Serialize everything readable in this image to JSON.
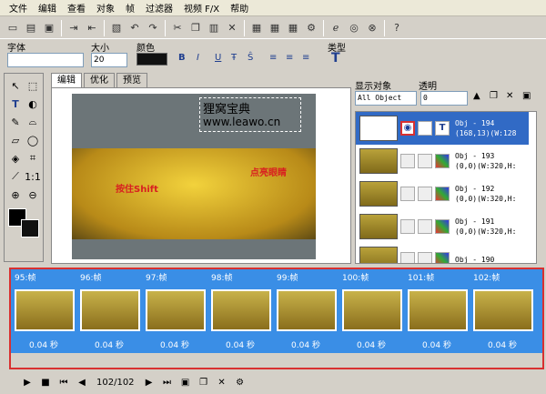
{
  "menu": [
    "文件",
    "编辑",
    "查看",
    "对象",
    "帧",
    "过滤器",
    "视频 F/X",
    "帮助"
  ],
  "props": {
    "font_label": "字体",
    "size_label": "大小",
    "size_value": "20",
    "color_label": "颜色",
    "type_label": "类型",
    "bold": "B",
    "italic": "I",
    "underline": "U"
  },
  "tabs": [
    "编辑",
    "优化",
    "预览"
  ],
  "canvas": {
    "title_cn": "狸窝宝典",
    "url": "www.leawo.cn",
    "annot_click": "点亮眼睛",
    "annot_select": "按住Shift"
  },
  "right_panel": {
    "display_label": "显示对象",
    "transparency_label": "透明",
    "filter_value": "All Object",
    "opacity_value": "0"
  },
  "objects": [
    {
      "name": "Obj - 194",
      "info": "(168,13)(W:128"
    },
    {
      "name": "Obj - 193",
      "info": "(0,0)(W:320,H:"
    },
    {
      "name": "Obj - 192",
      "info": "(0,0)(W:320,H:"
    },
    {
      "name": "Obj - 191",
      "info": "(0,0)(W:320,H:"
    },
    {
      "name": "Obj - 190",
      "info": ""
    }
  ],
  "frames": [
    {
      "label": "95:帧",
      "dur": "0.04 秒"
    },
    {
      "label": "96:帧",
      "dur": "0.04 秒"
    },
    {
      "label": "97:帧",
      "dur": "0.04 秒"
    },
    {
      "label": "98:帧",
      "dur": "0.04 秒"
    },
    {
      "label": "99:帧",
      "dur": "0.04 秒"
    },
    {
      "label": "100:帧",
      "dur": "0.04 秒"
    },
    {
      "label": "101:帧",
      "dur": "0.04 秒"
    },
    {
      "label": "102:帧",
      "dur": "0.04 秒"
    }
  ],
  "bottom": {
    "counter": "102/102"
  }
}
